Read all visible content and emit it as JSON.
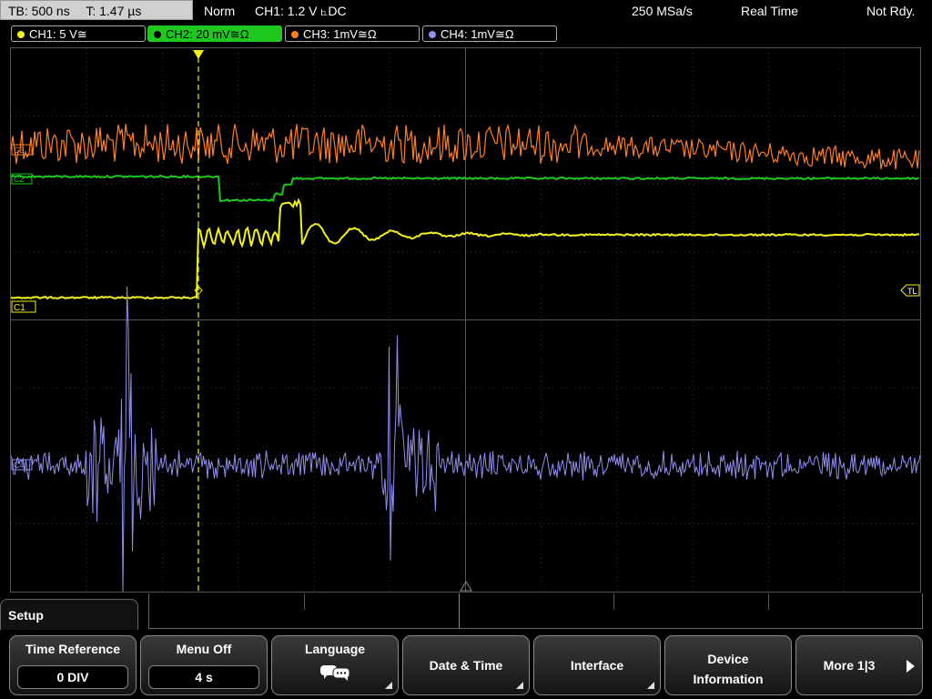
{
  "top": {
    "timebase": "TB: 500 ns",
    "trigger_time": "T: 1.47 µs",
    "mode": "Norm",
    "trigger_info": "CH1: 1.2 V ⦜DC",
    "sample_rate": "250 MSa/s",
    "acq_mode": "Real Time",
    "status": "Not Rdy."
  },
  "channels": [
    {
      "label": "CH1: 5 V≅",
      "color": "#f2f21a"
    },
    {
      "label": "CH2: 20 mV≅Ω",
      "color": "#1ec81e"
    },
    {
      "label": "CH3: 1mV≅Ω",
      "color": "#ff7f27"
    },
    {
      "label": "CH4: 1mV≅Ω",
      "color": "#8f8ff0"
    }
  ],
  "markers": {
    "c3": "C3",
    "c2": "C2",
    "c1": "C1",
    "c4": "C4",
    "trigger_level": "TL",
    "trigger": "T"
  },
  "menu": {
    "tab": "Setup",
    "keys": [
      {
        "title": "Time Reference",
        "value": "0 DIV"
      },
      {
        "title": "Menu Off",
        "value": "4 s"
      },
      {
        "title": "Language",
        "icon": "chat-bubbles-icon"
      },
      {
        "title": "Date & Time"
      },
      {
        "title": "Interface"
      },
      {
        "title_line1": "Device",
        "title_line2": "Information"
      },
      {
        "title": "More 1|3"
      }
    ]
  }
}
